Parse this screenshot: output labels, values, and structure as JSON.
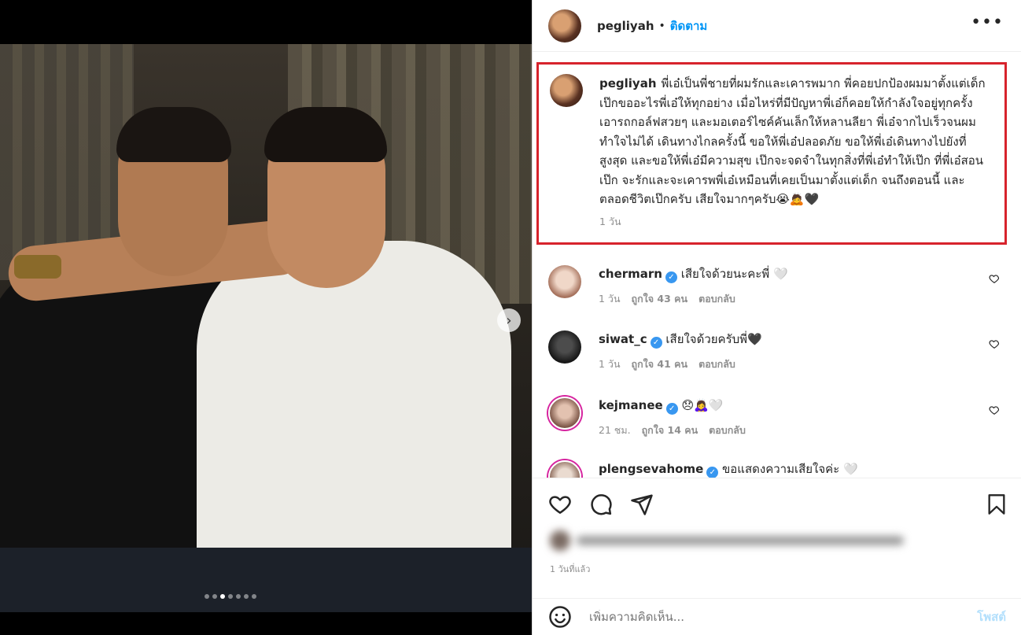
{
  "post": {
    "author": "pegliyah",
    "follow_label": "ติดตาม",
    "dot": "•",
    "more_label": "•••",
    "carousel": {
      "count": 7,
      "active_index": 2,
      "next_label": "›"
    }
  },
  "caption": {
    "username": "pegliyah",
    "text": "พี่เอ๋เป็นพี่ชายที่ผมรักและเคารพมาก พี่คอยปกป้องผมมาตั้งแต่เด็ก เป๊กขออะไรพี่เอ๋ให้ทุกอย่าง เมื่อไหร่ที่มีปัญหาพี่เอ๋ก็คอยให้กำลังใจอยู่ทุกครั้ง เอารถกอล์ฟสวยๆ และมอเตอร์ไซค์คันเล็กให้หลานลียา พี่เอ๋จากไปเร็วจนผมทำใจไม่ได้ เดินทางไกลครั้งนี้ ขอให้พี่เอ๋ปลอดภัย ขอให้พี่เอ๋เดินทางไปยังที่สูงสุด และขอให้พี่เอ๋มีความสุข เป๊กจะจดจำในทุกสิ่งที่พี่เอ๋ทำให้เป๊ก ที่พี่เอ๋สอนเป๊ก จะรักและจะเคารพพี่เอ๋เหมือนที่เคยเป็นมาตั้งแต่เด็ก จนถึงตอนนี้ และตลอดชีวิตเป๊กครับ เสียใจมากๆครับ😭🙇🖤",
    "time": "1 วัน"
  },
  "comments": [
    {
      "username": "chermarn",
      "verified": true,
      "text": "เสียใจด้วยนะคะพี่ 🤍",
      "time": "1 วัน",
      "likes": "ถูกใจ 43 คน",
      "reply": "ตอบกลับ"
    },
    {
      "username": "siwat_c",
      "verified": true,
      "text": "เสียใจด้วยครับพี่🖤",
      "time": "1 วัน",
      "likes": "ถูกใจ 41 คน",
      "reply": "ตอบกลับ"
    },
    {
      "username": "kejmanee",
      "verified": true,
      "text": "😞🙇‍♀️🤍",
      "time": "21 ชม.",
      "likes": "ถูกใจ 14 คน",
      "reply": "ตอบกลับ"
    },
    {
      "username": "plengsevahome",
      "verified": true,
      "text": "ขอแสดงความเสียใจค่ะ 🤍"
    }
  ],
  "footer": {
    "posted": "1 วันที่แล้ว",
    "comment_placeholder": "เพิ่มความคิดเห็น...",
    "post_label": "โพสต์"
  },
  "colors": {
    "accent": "#0095f6",
    "highlight_border": "#d7232c",
    "muted": "#8e8e8e"
  }
}
